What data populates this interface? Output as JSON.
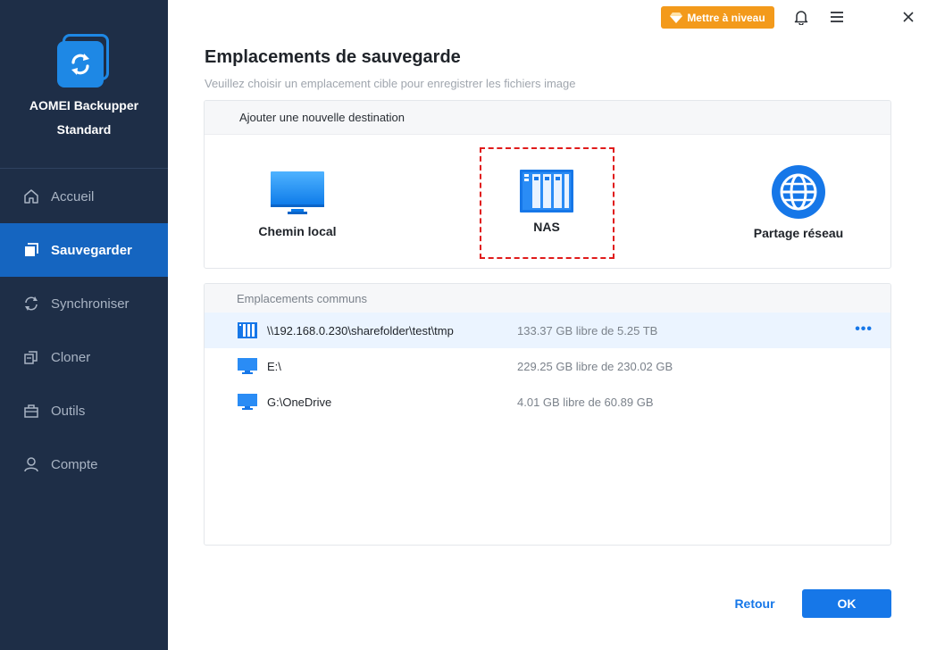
{
  "app": {
    "name": "AOMEI Backupper",
    "edition": "Standard"
  },
  "sidebar": {
    "items": [
      {
        "label": "Accueil",
        "icon": "home-icon"
      },
      {
        "label": "Sauvegarder",
        "icon": "backup-icon",
        "active": true
      },
      {
        "label": "Synchroniser",
        "icon": "sync-icon"
      },
      {
        "label": "Cloner",
        "icon": "clone-icon"
      },
      {
        "label": "Outils",
        "icon": "tools-icon"
      },
      {
        "label": "Compte",
        "icon": "account-icon"
      }
    ]
  },
  "topbar": {
    "upgrade_label": "Mettre à niveau",
    "icons": [
      "bell-icon",
      "menu-icon",
      "close-icon"
    ]
  },
  "main": {
    "title": "Emplacements de sauvegarde",
    "subtitle": "Veuillez choisir un emplacement cible pour enregistrer les fichiers image",
    "add_destination": {
      "header": "Ajouter une nouvelle destination",
      "options": [
        {
          "label": "Chemin local",
          "icon": "monitor-icon"
        },
        {
          "label": "NAS",
          "icon": "nas-icon",
          "highlighted": true
        },
        {
          "label": "Partage réseau",
          "icon": "globe-icon"
        }
      ]
    },
    "common_locations": {
      "header": "Emplacements communs",
      "rows": [
        {
          "path": "\\\\192.168.0.230\\sharefolder\\test\\tmp",
          "space": "133.37 GB libre de 5.25 TB",
          "icon": "nas-icon",
          "selected": true,
          "more": "•••"
        },
        {
          "path": "E:\\",
          "space": "229.25 GB libre de 230.02 GB",
          "icon": "monitor-icon"
        },
        {
          "path": "G:\\OneDrive",
          "space": "4.01 GB libre de 60.89 GB",
          "icon": "monitor-icon"
        }
      ]
    }
  },
  "footer": {
    "back_label": "Retour",
    "ok_label": "OK"
  },
  "colors": {
    "sidebar_bg": "#1e2e47",
    "active_nav": "#1565c0",
    "accent": "#1677e8",
    "upgrade": "#f39a1b",
    "highlight_border": "#e01b1b"
  }
}
